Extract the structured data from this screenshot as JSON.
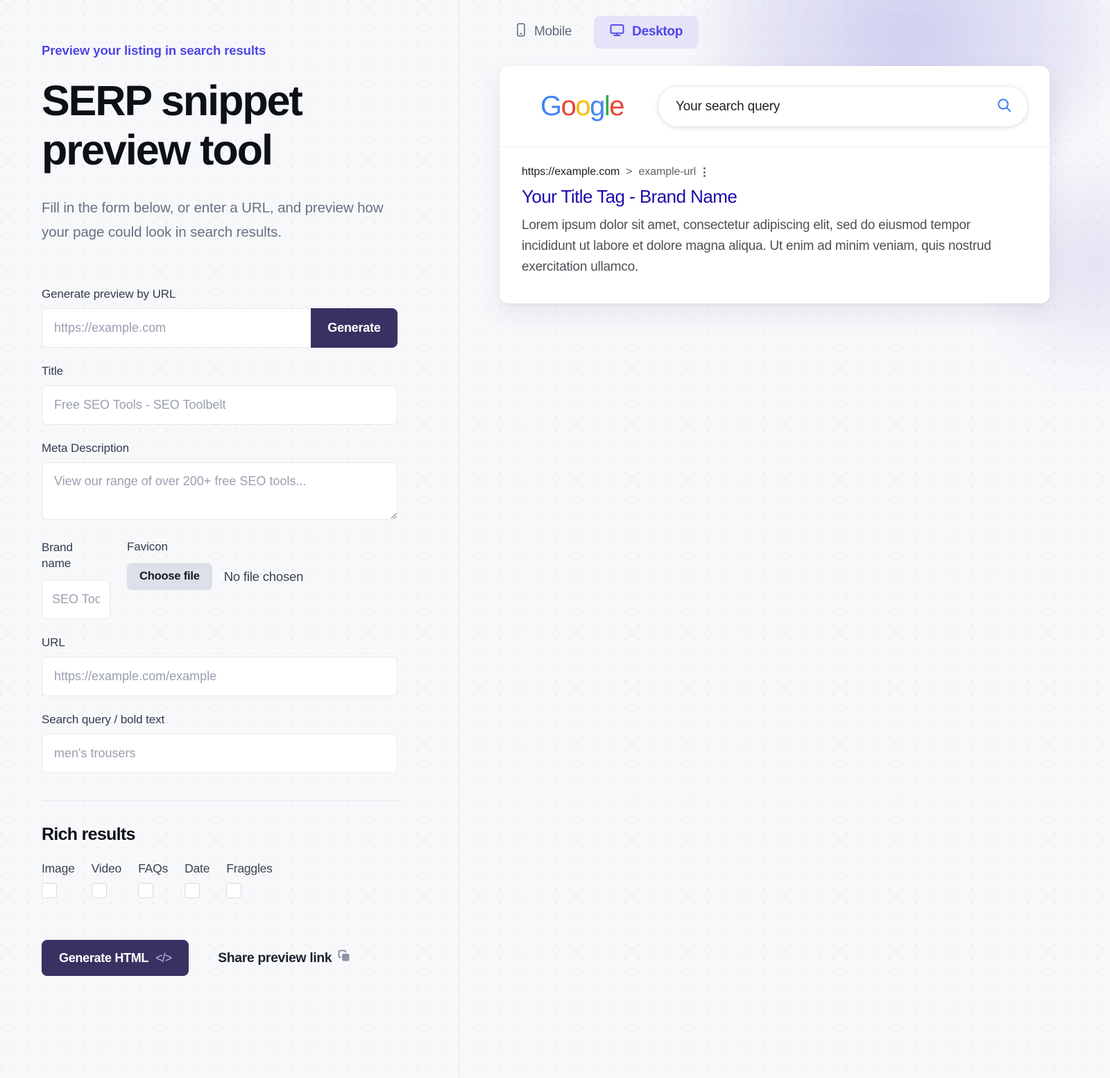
{
  "left": {
    "eyebrow": "Preview your listing in search results",
    "title": "SERP snippet preview tool",
    "intro": "Fill in the form below, or enter a URL, and preview how your page could look in search results.",
    "form": {
      "url_generate": {
        "label": "Generate preview by URL",
        "placeholder": "https://example.com",
        "value": "",
        "button_label": "Generate"
      },
      "title_field": {
        "label": "Title",
        "placeholder": "Free SEO Tools - SEO Toolbelt",
        "value": ""
      },
      "meta_description": {
        "label": "Meta Description",
        "placeholder": "View our range of over 200+ free SEO tools...",
        "value": ""
      },
      "brand_name": {
        "label": "Brand name",
        "placeholder": "SEO Toolbelt",
        "value": ""
      },
      "favicon": {
        "label": "Favicon",
        "choose_label": "Choose file",
        "status": "No file chosen"
      },
      "url_field": {
        "label": "URL",
        "placeholder": "https://example.com/example",
        "value": ""
      },
      "search_query": {
        "label": "Search query / bold text",
        "placeholder": "men's trousers",
        "value": ""
      }
    },
    "rich_results": {
      "heading": "Rich results",
      "options": [
        {
          "label": "Image",
          "checked": false
        },
        {
          "label": "Video",
          "checked": false
        },
        {
          "label": "FAQs",
          "checked": false
        },
        {
          "label": "Date",
          "checked": false
        },
        {
          "label": "Fraggles",
          "checked": false
        }
      ]
    },
    "actions": {
      "generate_html_label": "Generate HTML",
      "code_glyph": "</>",
      "share_label": "Share preview link"
    }
  },
  "preview": {
    "tabs": [
      {
        "label": "Mobile",
        "icon": "mobile-icon",
        "active": false
      },
      {
        "label": "Desktop",
        "icon": "desktop-icon",
        "active": true
      }
    ],
    "google": {
      "logo_letters": [
        "G",
        "o",
        "o",
        "g",
        "l",
        "e"
      ],
      "search_value": "Your search query",
      "search_icon": "search-icon"
    },
    "result": {
      "domain": "https://example.com",
      "separator": ">",
      "path": "example-url",
      "title": "Your Title Tag - Brand Name",
      "description": "Lorem ipsum dolor sit amet, consectetur adipiscing elit, sed do eiusmod tempor incididunt ut labore et dolore magna aliqua. Ut enim ad minim veniam, quis nostrud exercitation ullamco."
    }
  },
  "colors": {
    "accent": "#4f46e5",
    "dark_button": "#383263",
    "link_blue": "#1a0dab",
    "tab_active_bg": "#e4e3fa"
  }
}
